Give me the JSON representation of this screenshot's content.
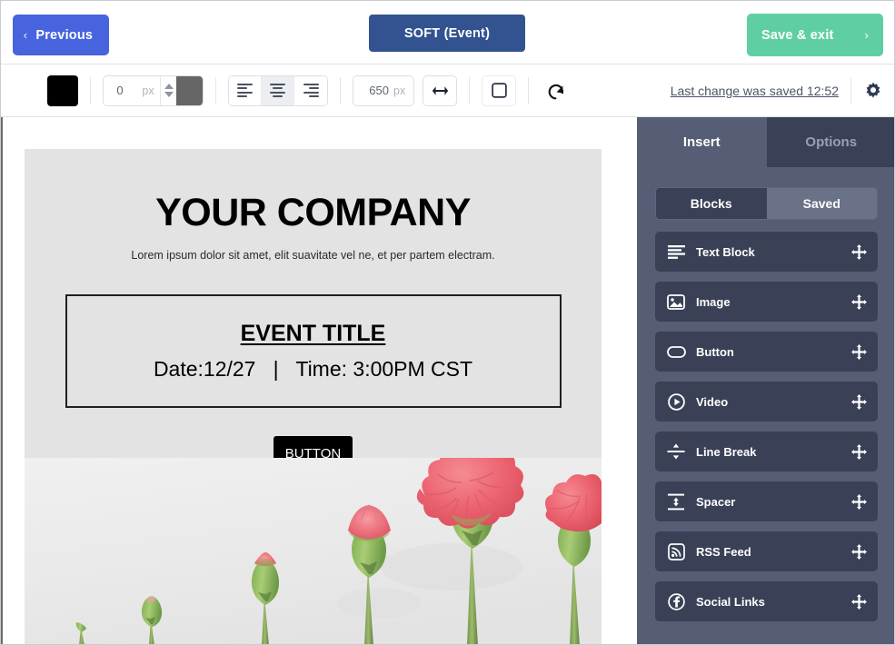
{
  "header": {
    "previous_label": "Previous",
    "previous_chevron": "‹",
    "title_label": "SOFT (Event)",
    "save_exit_label": "Save & exit",
    "save_exit_chevron": "›",
    "colors": {
      "previous_bg": "#4763dd",
      "title_bg": "#32538f",
      "save_exit_bg": "#5fcfa3"
    }
  },
  "toolbar": {
    "text_color_swatch": "#000000",
    "border_radius_value": "0",
    "border_radius_unit": "px",
    "border_color_swatch": "#666666",
    "align_options": [
      "align-left",
      "align-center",
      "align-right"
    ],
    "align_selected": "align-center",
    "width_value": "650",
    "width_unit": "px",
    "full_width_icon": "arrows-horizontal-icon",
    "border_icon": "rounded-square-icon",
    "reset_icon": "undo-icon",
    "saved_note": "Last change was saved 12:52",
    "settings_icon": "gear-icon"
  },
  "email": {
    "company_title": "YOUR COMPANY",
    "company_subtitle": "Lorem ipsum dolor sit amet, elit suavitate vel ne, et per partem electram.",
    "event_title": "EVENT TITLE",
    "event_when": "Date:12/27   |   Time: 3:00PM CST",
    "cta_label": "BUTTON",
    "background": "#e3e3e3",
    "cta_background": "#000000",
    "photo_alt": "carnation-flowers-blooming-stages"
  },
  "sidebar": {
    "tabs": [
      {
        "label": "Insert",
        "active": true
      },
      {
        "label": "Options",
        "active": false
      }
    ],
    "segmented": [
      {
        "label": "Blocks",
        "active": true
      },
      {
        "label": "Saved",
        "active": false
      }
    ],
    "blocks": [
      {
        "label": "Text Block",
        "icon": "text-lines-icon"
      },
      {
        "label": "Image",
        "icon": "image-icon"
      },
      {
        "label": "Button",
        "icon": "pill-button-icon"
      },
      {
        "label": "Video",
        "icon": "play-circle-icon"
      },
      {
        "label": "Line Break",
        "icon": "line-break-icon"
      },
      {
        "label": "Spacer",
        "icon": "spacer-icon"
      },
      {
        "label": "RSS Feed",
        "icon": "rss-icon"
      },
      {
        "label": "Social Links",
        "icon": "facebook-circle-icon"
      }
    ],
    "drag_icon": "move-arrows-icon",
    "colors": {
      "panel_bg": "#565e75",
      "item_bg": "#3a4156"
    }
  }
}
